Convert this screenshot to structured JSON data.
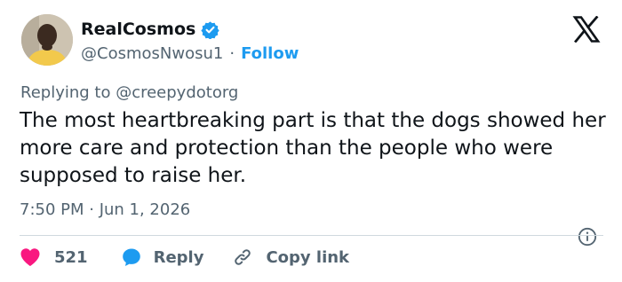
{
  "author": {
    "name": "RealCosmos",
    "handle": "@CosmosNwosu1",
    "separator": "·",
    "follow_label": "Follow"
  },
  "tweet": {
    "replying_to": "Replying to @creepydotorg",
    "text": "The most heartbreaking part is that the dogs showed her more care and protection than the people who were supposed to raise her.",
    "time": "7:50 PM · Jun 1, 2026"
  },
  "actions": {
    "like_count": "521",
    "reply_label": "Reply",
    "copy_link_label": "Copy link"
  },
  "icons": {
    "verified": "verified-badge-icon",
    "x_logo": "x-logo-icon",
    "info": "info-icon",
    "heart": "heart-icon",
    "reply": "reply-bubble-icon",
    "link": "link-icon"
  },
  "colors": {
    "text": "#0f1419",
    "secondary": "#536471",
    "accent": "#1d9bf0",
    "like": "#f91880",
    "divider": "#cfd9de"
  }
}
